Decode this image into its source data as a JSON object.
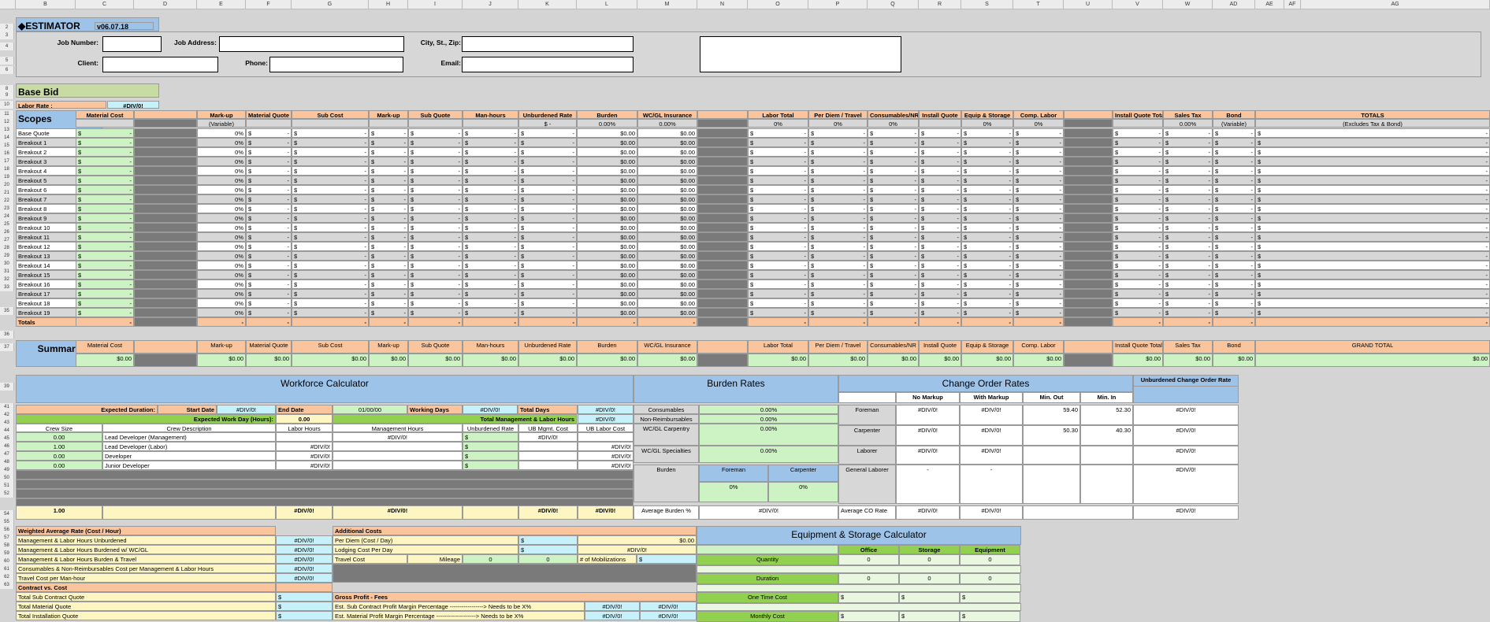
{
  "columns": [
    "B",
    "C",
    "D",
    "E",
    "F",
    "G",
    "H",
    "I",
    "J",
    "K",
    "L",
    "M",
    "N",
    "O",
    "P",
    "Q",
    "R",
    "S",
    "T",
    "U",
    "V",
    "W",
    "AD",
    "AE",
    "AF",
    "AG"
  ],
  "title": "◆ESTIMATOR",
  "version": "v06.07.18",
  "job": {
    "job_number": "Job Number:",
    "job_address": "Job Address:",
    "city": "City, St., Zip:",
    "client": "Client:",
    "phone": "Phone:",
    "email": "Email:"
  },
  "base_bid": "Base Bid",
  "labor_rate_label": "Labor Rate :",
  "labor_rate_value": "#DIV/0!",
  "scopes": "Scopes",
  "headers": [
    "Material Cost",
    "",
    "Mark-up",
    "Material Quote",
    "Sub Cost",
    "Mark-up",
    "Sub Quote",
    "Man-hours",
    "Unburdened Rate",
    "Burden",
    "WC/GL Insurance",
    "",
    "Labor Total",
    "Per Diem / Travel",
    "Consumables/NR",
    "Install Quote",
    "Equip & Storage",
    "Comp. Labor",
    "",
    "Install Quote Total",
    "Sales Tax",
    "Bond",
    "TOTALS"
  ],
  "subheaders": [
    "",
    "",
    "(Variable)",
    "",
    "",
    "",
    "",
    "",
    "$ -",
    "0.00%",
    "0.00%",
    "",
    "0%",
    "0%",
    "0%",
    "",
    "0%",
    "0%",
    "",
    "",
    "0.00%",
    "(Variable)",
    "(Excludes Tax & Bond)"
  ],
  "rows": [
    "Base Quote",
    "Breakout 1",
    "Breakout 2",
    "Breakout 3",
    "Breakout 4",
    "Breakout 5",
    "Breakout 6",
    "Breakout 7",
    "Breakout 8",
    "Breakout 9",
    "Breakout 10",
    "Breakout 11",
    "Breakout 12",
    "Breakout 13",
    "Breakout 14",
    "Breakout 15",
    "Breakout 16",
    "Breakout 17",
    "Breakout 18",
    "Breakout 19"
  ],
  "row_numbers": [
    "2",
    "3",
    "4",
    "5",
    "6",
    "8",
    "9",
    "10",
    "11",
    "12",
    "13",
    "14",
    "15",
    "16",
    "17",
    "18",
    "19",
    "20",
    "21",
    "22",
    "23",
    "24",
    "25",
    "26",
    "27",
    "28",
    "29",
    "30",
    "31",
    "32",
    "33",
    "35",
    "36",
    "37",
    "39",
    "41",
    "42",
    "43",
    "44",
    "45",
    "46",
    "47",
    "48",
    "49",
    "50",
    "51",
    "52",
    "54",
    "55",
    "56",
    "57",
    "58",
    "59",
    "60",
    "61",
    "62",
    "63"
  ],
  "totals_label": "Totals",
  "val": {
    "dollar": "$",
    "dash": "-",
    "zero_pct": "0%",
    "zero_money": "$0.00",
    "div0": "#DIV/0!"
  },
  "summary": {
    "label": "Summary",
    "headers": [
      "Material Cost",
      "",
      "Mark-up",
      "Material Quote",
      "Sub Cost",
      "Mark-up",
      "Sub Quote",
      "Man-hours",
      "Unburdened Rate",
      "Burden",
      "WC/GL Insurance",
      "",
      "Labor Total",
      "Per Diem / Travel",
      "Consumables/NR",
      "Install Quote",
      "Equip & Storage",
      "Comp. Labor",
      "",
      "Install Quote Total",
      "Sales Tax",
      "Bond",
      "GRAND TOTAL"
    ]
  },
  "workforce": {
    "title": "Workforce Calculator",
    "expected_duration": "Expected Duration:",
    "start_date": "Start Date",
    "start_val": "#DIV/0!",
    "end_date": "End Date",
    "end_val": "01/00/00",
    "working_days": "Working Days",
    "wd_val": "#DIV/0!",
    "total_days": "Total Days",
    "td_val": "#DIV/0!",
    "work_day": "Expected Work Day (Hours):",
    "work_day_val": "0.00",
    "total_mgmt": "Total Management & Labor Hours",
    "total_mgmt_val": "#DIV/0!",
    "cols": [
      "Crew Size",
      "Crew Description",
      "Labor Hours",
      "Management Hours",
      "Unburdened Rate",
      "UB Mgmt. Cost",
      "UB Labor Cost"
    ],
    "crew": [
      {
        "size": "0.00",
        "desc": "Lead Developer (Management)"
      },
      {
        "size": "1.00",
        "desc": "Lead Developer (Labor)"
      },
      {
        "size": "0.00",
        "desc": "Developer"
      },
      {
        "size": "0.00",
        "desc": "Junior Developer"
      }
    ],
    "total_size": "1.00"
  },
  "burden": {
    "title": "Burden Rates",
    "items": [
      {
        "label": "Consumables",
        "value": "0.00%"
      },
      {
        "label": "Non-Reimbursables",
        "value": "0.00%"
      },
      {
        "label": "WC/GL Carpentry",
        "value": "0.00%"
      },
      {
        "label": "WC/GL Specialties",
        "value": "0.00%"
      }
    ],
    "burden": "Burden",
    "foreman": "Foreman",
    "carpenter": "Carpenter",
    "avg": "Average Burden %",
    "avg_val": "#DIV/0!"
  },
  "change": {
    "title": "Change Order Rates",
    "cols": [
      "No Markup",
      "With Markup",
      "Min. Out",
      "Min. In"
    ],
    "rows": [
      "Foreman",
      "Carpenter",
      "Laborer",
      "General Laborer"
    ],
    "foreman_out": "59.40",
    "foreman_in": "52.30",
    "carpenter_out": "50.30",
    "carpenter_in": "40.30",
    "avg": "Average CO Rate"
  },
  "unburdened": {
    "title": "Unburdened Change Order Rate"
  },
  "wavg": {
    "title": "Weighted Average Rate (Cost / Hour)",
    "items": [
      "Management & Labor Hours Unburdened",
      "Management & Labor Hours Burdened w/ WC/GL",
      "Management & Labor Hours Burden & Travel",
      "Consumables & Non-Reimbursables Cost per Management & Labor Hours",
      "Travel Cost per Man-hour"
    ]
  },
  "additional": {
    "title": "Additional Costs",
    "items": [
      "Per Diem (Cost / Day)",
      "Lodging Cost Per Day",
      "Travel Cost"
    ],
    "mileage": "Mileage",
    "zero": "0",
    "mobil": "# of Mobilizations"
  },
  "contract": {
    "title": "Contract  vs.  Cost",
    "items": [
      "Total Sub Contract Quote",
      "Total Material Quote",
      "Total Installation Quote"
    ]
  },
  "gross": {
    "title": "Gross Profit  -  Fees",
    "items": [
      "Est. Sub Contract Profit Margin Percentage -----------------> Needs to be X%",
      "Est. Material Profit Margin Percentage --------------------> Needs to be X%"
    ]
  },
  "equip": {
    "title": "Equipment & Storage Calculator",
    "cols": [
      "Office",
      "Storage",
      "Equipment"
    ],
    "rows": [
      "Quantity",
      "Duration",
      "One Time Cost",
      "Monthly Cost"
    ]
  }
}
